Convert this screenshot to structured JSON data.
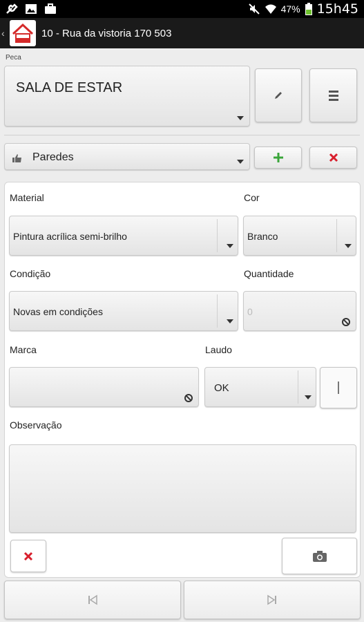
{
  "status_bar": {
    "battery": "47%",
    "time": "15h45",
    "icons": [
      "wrench-icon",
      "image-icon",
      "briefcase-icon",
      "mute-icon",
      "wifi-icon",
      "battery-icon"
    ]
  },
  "action_bar": {
    "title": "10 - Rua da vistoria 170 503"
  },
  "peca": {
    "label": "Peca",
    "value": "SALA DE ESTAR"
  },
  "item": {
    "value": "Paredes"
  },
  "form": {
    "material_label": "Material",
    "material_value": "Pintura acrílica semi-brilho",
    "cor_label": "Cor",
    "cor_value": "Branco",
    "condicao_label": "Condição",
    "condicao_value": "Novas em condições",
    "quantidade_label": "Quantidade",
    "quantidade_placeholder": "0",
    "marca_label": "Marca",
    "marca_value": "",
    "laudo_label": "Laudo",
    "laudo_value": "OK",
    "observacao_label": "Observação",
    "observacao_value": ""
  },
  "colors": {
    "add_green": "#3aa53a",
    "delete_red": "#d81e2c"
  }
}
